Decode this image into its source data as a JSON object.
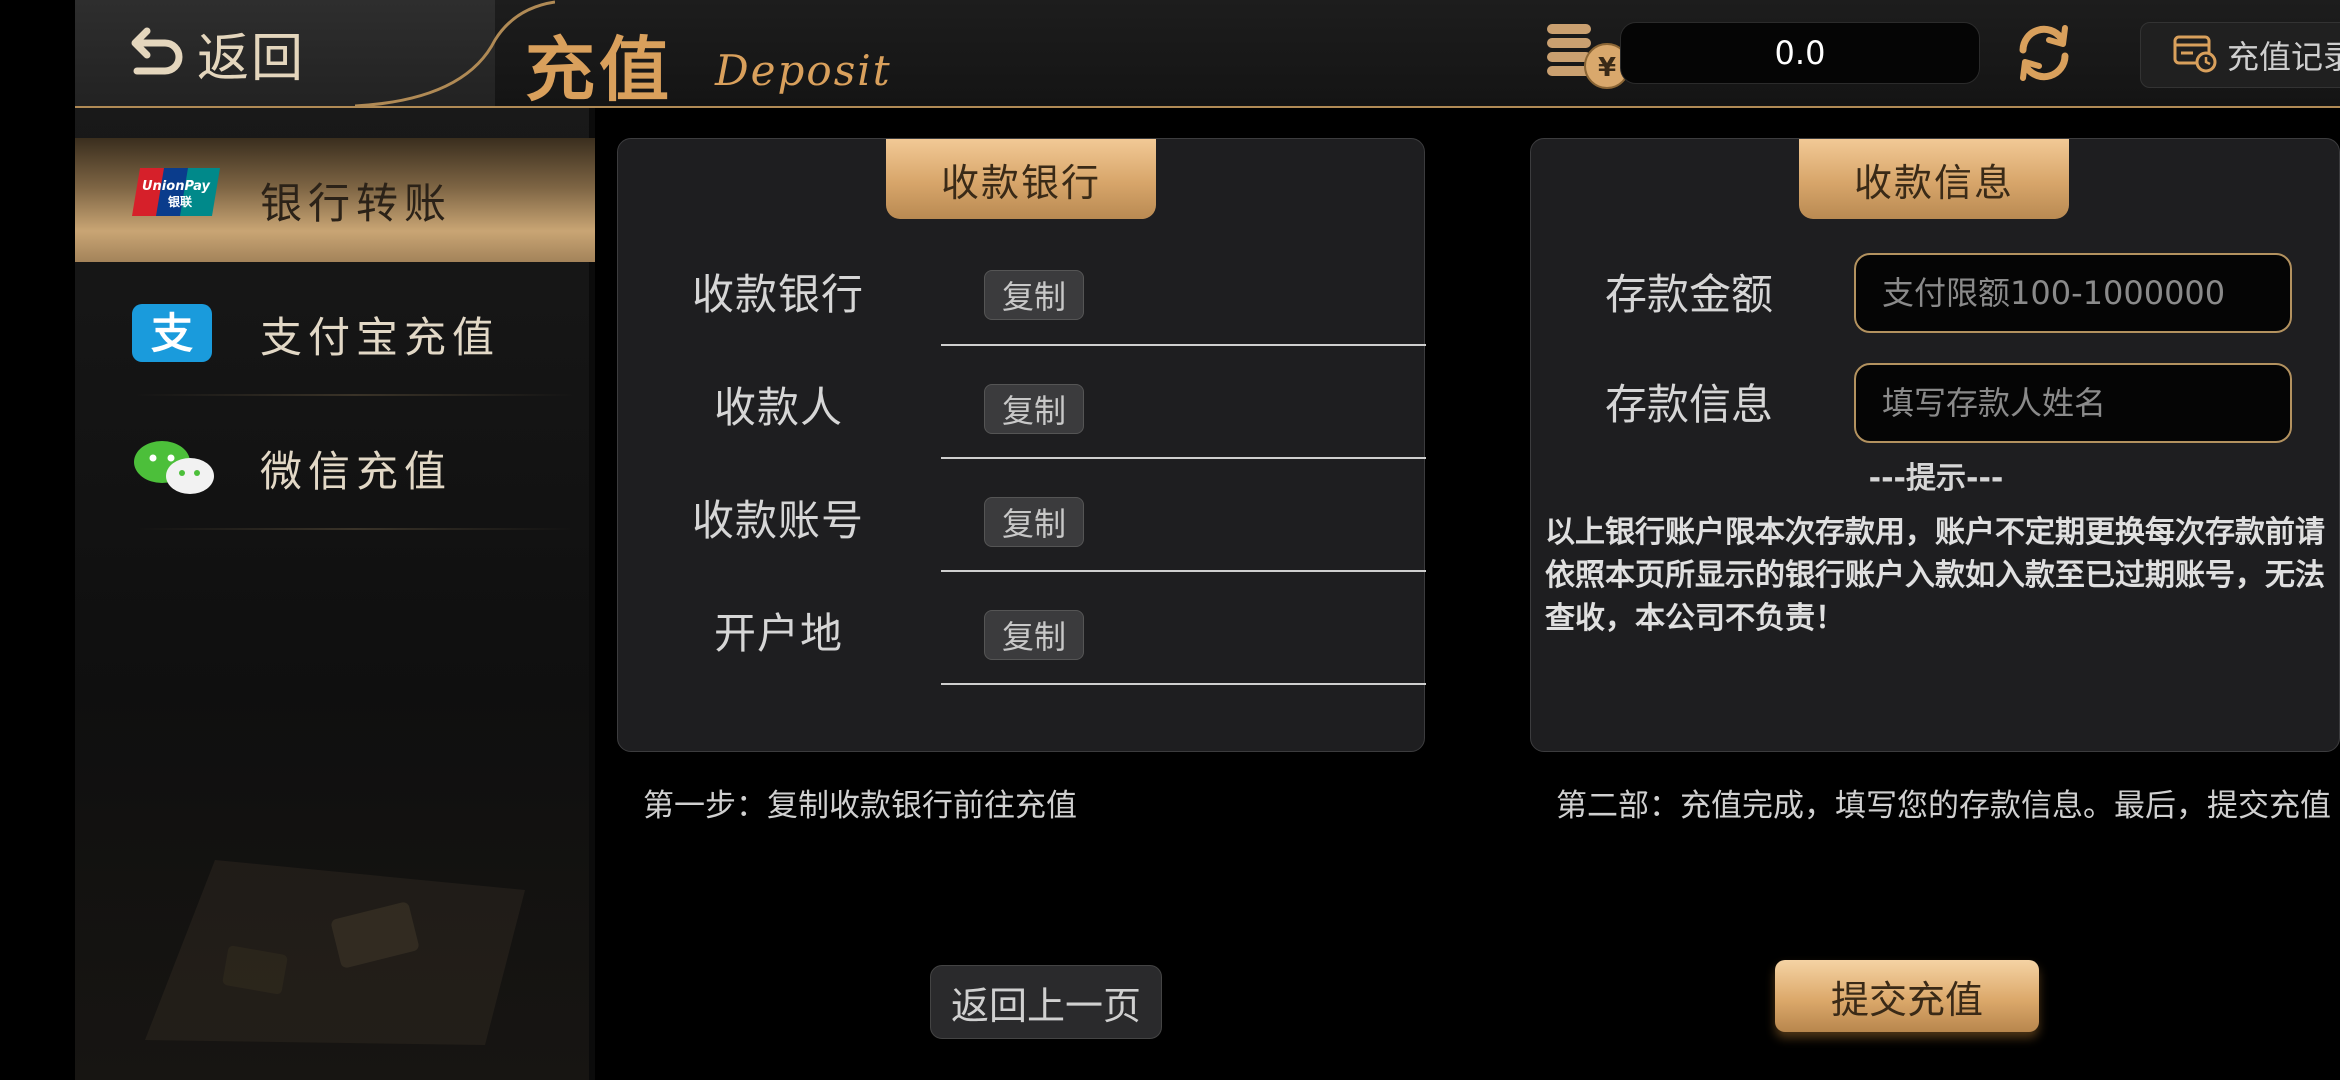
{
  "header": {
    "back_label": "返回",
    "title_cn": "充值",
    "title_en": "Deposit",
    "balance": "0.0",
    "records_label": "充值记录"
  },
  "sidebar": {
    "items": [
      {
        "label": "银行转账",
        "icon": "unionpay-icon",
        "active": true
      },
      {
        "label": "支付宝充值",
        "icon": "alipay-icon",
        "active": false
      },
      {
        "label": "微信充值",
        "icon": "wechat-icon",
        "active": false
      }
    ]
  },
  "bank_panel": {
    "tab_label": "收款银行",
    "rows": [
      {
        "label": "收款银行",
        "copy_label": "复制",
        "value": ""
      },
      {
        "label": "收款人",
        "copy_label": "复制",
        "value": ""
      },
      {
        "label": "收款账号",
        "copy_label": "复制",
        "value": ""
      },
      {
        "label": "开户地",
        "copy_label": "复制",
        "value": ""
      }
    ],
    "step_text": "第一步：复制收款银行前往充值"
  },
  "info_panel": {
    "tab_label": "收款信息",
    "amount_label": "存款金额",
    "amount_placeholder": "支付限额100-1000000",
    "depositor_label": "存款信息",
    "depositor_placeholder": "填写存款人姓名",
    "hint_title": "---提示---",
    "hint_text": "以上银行账户限本次存款用，账户不定期更换每次存款前请依照本页所显示的银行账户入款如入款至已过期账号，无法查收，本公司不负责！",
    "step_text": "第二部：充值完成，填写您的存款信息。最后，提交充值"
  },
  "actions": {
    "back_page_label": "返回上一页",
    "submit_label": "提交充值"
  },
  "colors": {
    "accent_gold": "#d9a05c",
    "tab_gold": "#d7a56a",
    "background": "#000000"
  }
}
